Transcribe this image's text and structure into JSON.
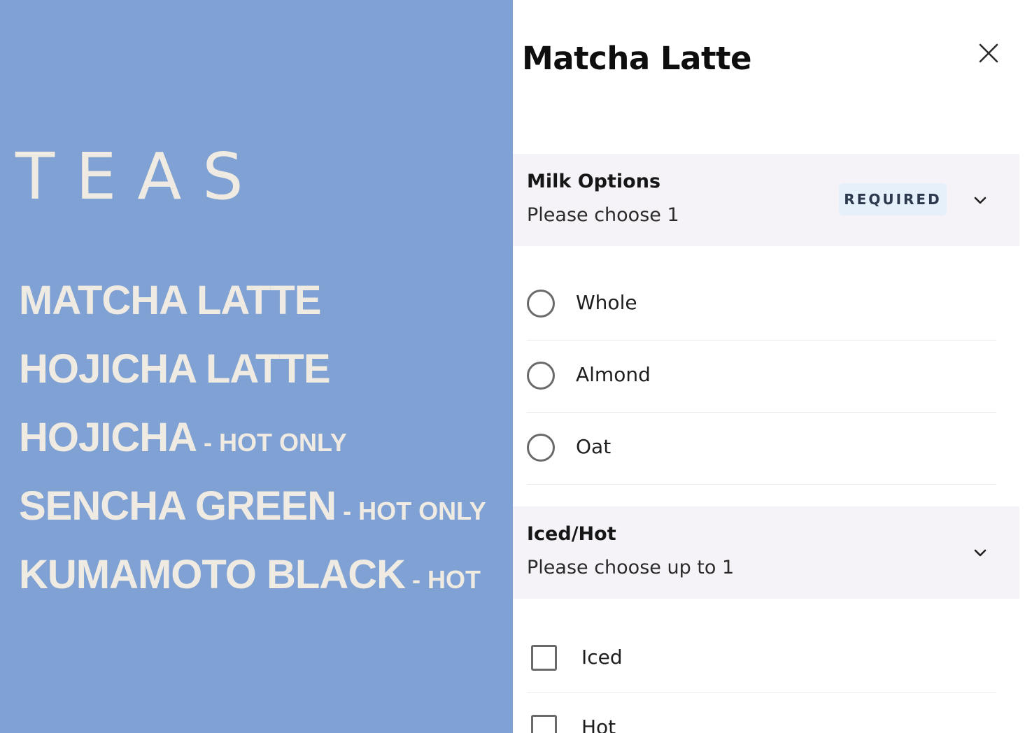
{
  "menu": {
    "heading": "TEAS",
    "items": [
      {
        "name": "MATCHA LATTE",
        "note": ""
      },
      {
        "name": "HOJICHA LATTE",
        "note": ""
      },
      {
        "name": "HOJICHA",
        "note": "- HOT ONLY"
      },
      {
        "name": "SENCHA GREEN",
        "note": "- HOT ONLY"
      },
      {
        "name": "KUMAMOTO BLACK",
        "note": "- HOT"
      }
    ],
    "background_color": "#7fa1d3",
    "text_color": "#f0ebe2"
  },
  "modal": {
    "title": "Matcha Latte",
    "close_icon": "close-icon",
    "sections": [
      {
        "title": "Milk Options",
        "subtitle": "Please choose 1",
        "badge": "REQUIRED",
        "control": "radio",
        "options": [
          {
            "label": "Whole",
            "selected": false
          },
          {
            "label": "Almond",
            "selected": false
          },
          {
            "label": "Oat",
            "selected": false
          }
        ]
      },
      {
        "title": "Iced/Hot",
        "subtitle": "Please choose up to 1",
        "badge": "",
        "control": "checkbox",
        "options": [
          {
            "label": "Iced",
            "checked": false
          },
          {
            "label": "Hot",
            "checked": false
          }
        ]
      }
    ]
  },
  "colors": {
    "section_header_bg": "#f5f3f7",
    "badge_bg": "#e5f0fb"
  }
}
